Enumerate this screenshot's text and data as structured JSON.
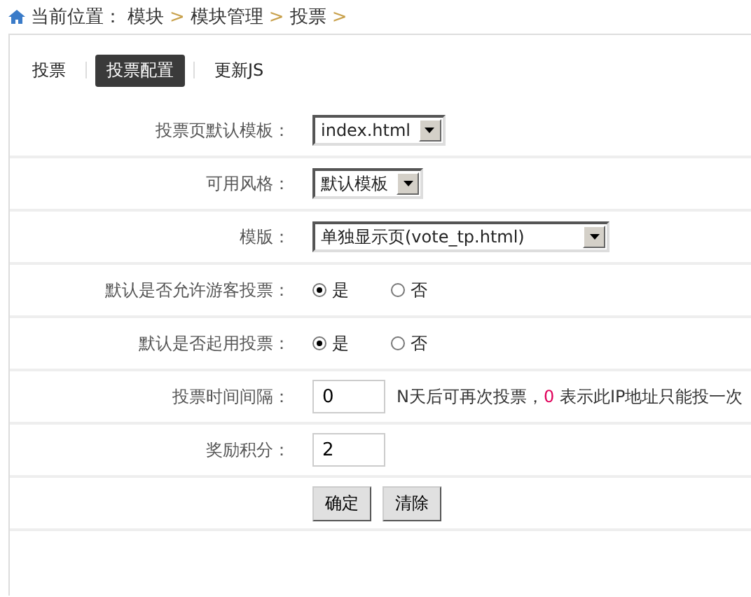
{
  "breadcrumb": {
    "label": "当前位置：",
    "items": [
      "模块",
      "模块管理",
      "投票"
    ],
    "separator": ">"
  },
  "tabs": [
    {
      "label": "投票",
      "selected": false
    },
    {
      "label": "投票配置",
      "selected": true
    },
    {
      "label": "更新JS",
      "selected": false
    }
  ],
  "form": {
    "rows": [
      {
        "kind": "select",
        "label": "投票页默认模板：",
        "value": "index.html"
      },
      {
        "kind": "select",
        "label": "可用风格：",
        "value": "默认模板"
      },
      {
        "kind": "wide-select",
        "label": "模版：",
        "value": "单独显示页(vote_tp.html)"
      },
      {
        "kind": "radio",
        "label": "默认是否允许游客投票：",
        "options": [
          {
            "label": "是",
            "selected": true
          },
          {
            "label": "否",
            "selected": false
          }
        ]
      },
      {
        "kind": "radio",
        "label": "默认是否起用投票：",
        "options": [
          {
            "label": "是",
            "selected": true
          },
          {
            "label": "否",
            "selected": false
          }
        ]
      },
      {
        "kind": "input",
        "label": "投票时间间隔：",
        "value": "0",
        "hint": {
          "before": "N天后可再次投票，",
          "highlight": "0",
          "after": " 表示此IP地址只能投一次"
        }
      },
      {
        "kind": "input",
        "label": "奖励积分：",
        "value": "2"
      }
    ],
    "buttons": [
      "确定",
      "清除"
    ]
  }
}
